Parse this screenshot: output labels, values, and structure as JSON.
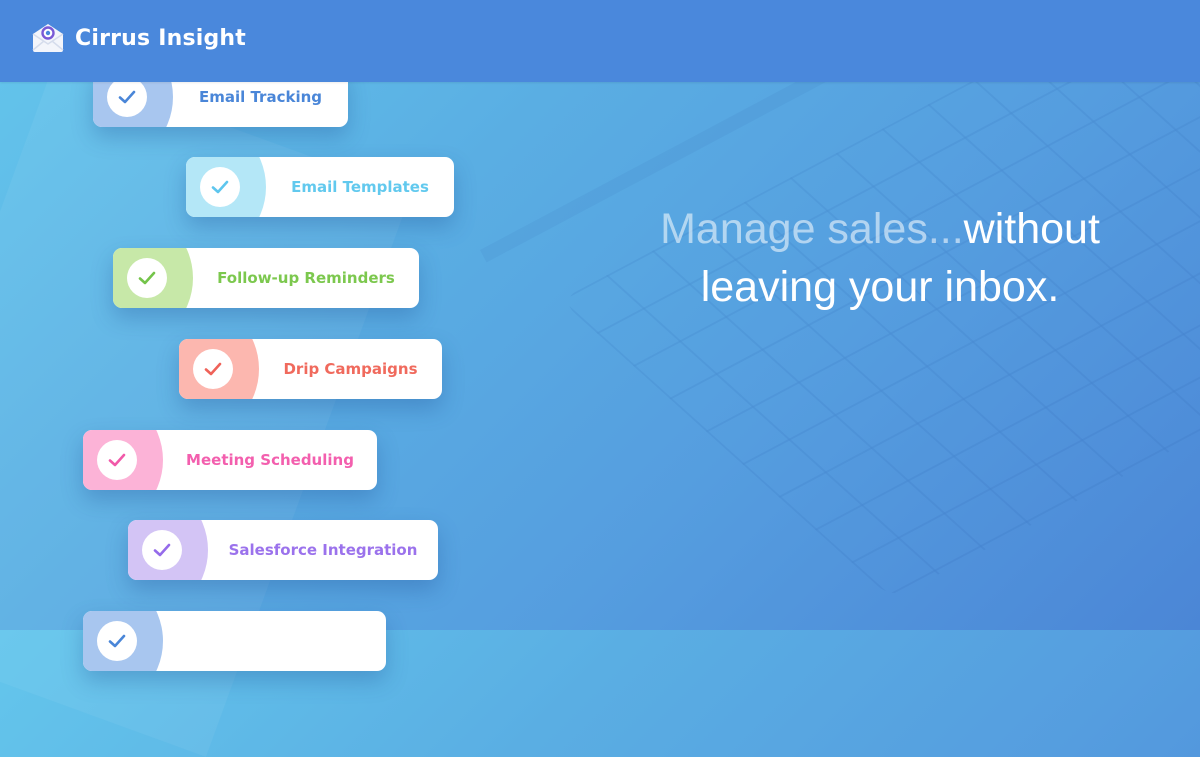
{
  "header": {
    "brand_name": "Cirrus Insight",
    "brand_icon": "envelope-eye-icon",
    "background": "#4a88dc"
  },
  "headline": {
    "muted_part": "Manage sales...",
    "bright_part_1": "without",
    "bright_part_2": "leaving your inbox."
  },
  "features": [
    {
      "label": "Email Tracking",
      "icon": "checkmark-icon",
      "text_color": "#4a86d8",
      "lobe_color": "#a8c6ef",
      "check_color": "#4a86d8"
    },
    {
      "label": "Email Templates",
      "icon": "checkmark-icon",
      "text_color": "#62c9ee",
      "lobe_color": "#b4e7f7",
      "check_color": "#5ec6ee"
    },
    {
      "label": "Follow-up Reminders",
      "icon": "checkmark-icon",
      "text_color": "#7cc84e",
      "lobe_color": "#c7e8a8",
      "check_color": "#74c44a"
    },
    {
      "label": "Drip Campaigns",
      "icon": "checkmark-icon",
      "text_color": "#f06a5d",
      "lobe_color": "#fcb7af",
      "check_color": "#ef6259"
    },
    {
      "label": "Meeting Scheduling",
      "icon": "checkmark-icon",
      "text_color": "#f35fae",
      "lobe_color": "#fcb3d7",
      "check_color": "#f159a9"
    },
    {
      "label": "Salesforce Integration",
      "icon": "checkmark-icon",
      "text_color": "#9b72ec",
      "lobe_color": "#d3c4f5",
      "check_color": "#956bea"
    },
    {
      "label": "",
      "icon": "checkmark-icon",
      "text_color": "#4a86d8",
      "lobe_color": "#a8c6ef",
      "check_color": "#4a86d8"
    }
  ]
}
